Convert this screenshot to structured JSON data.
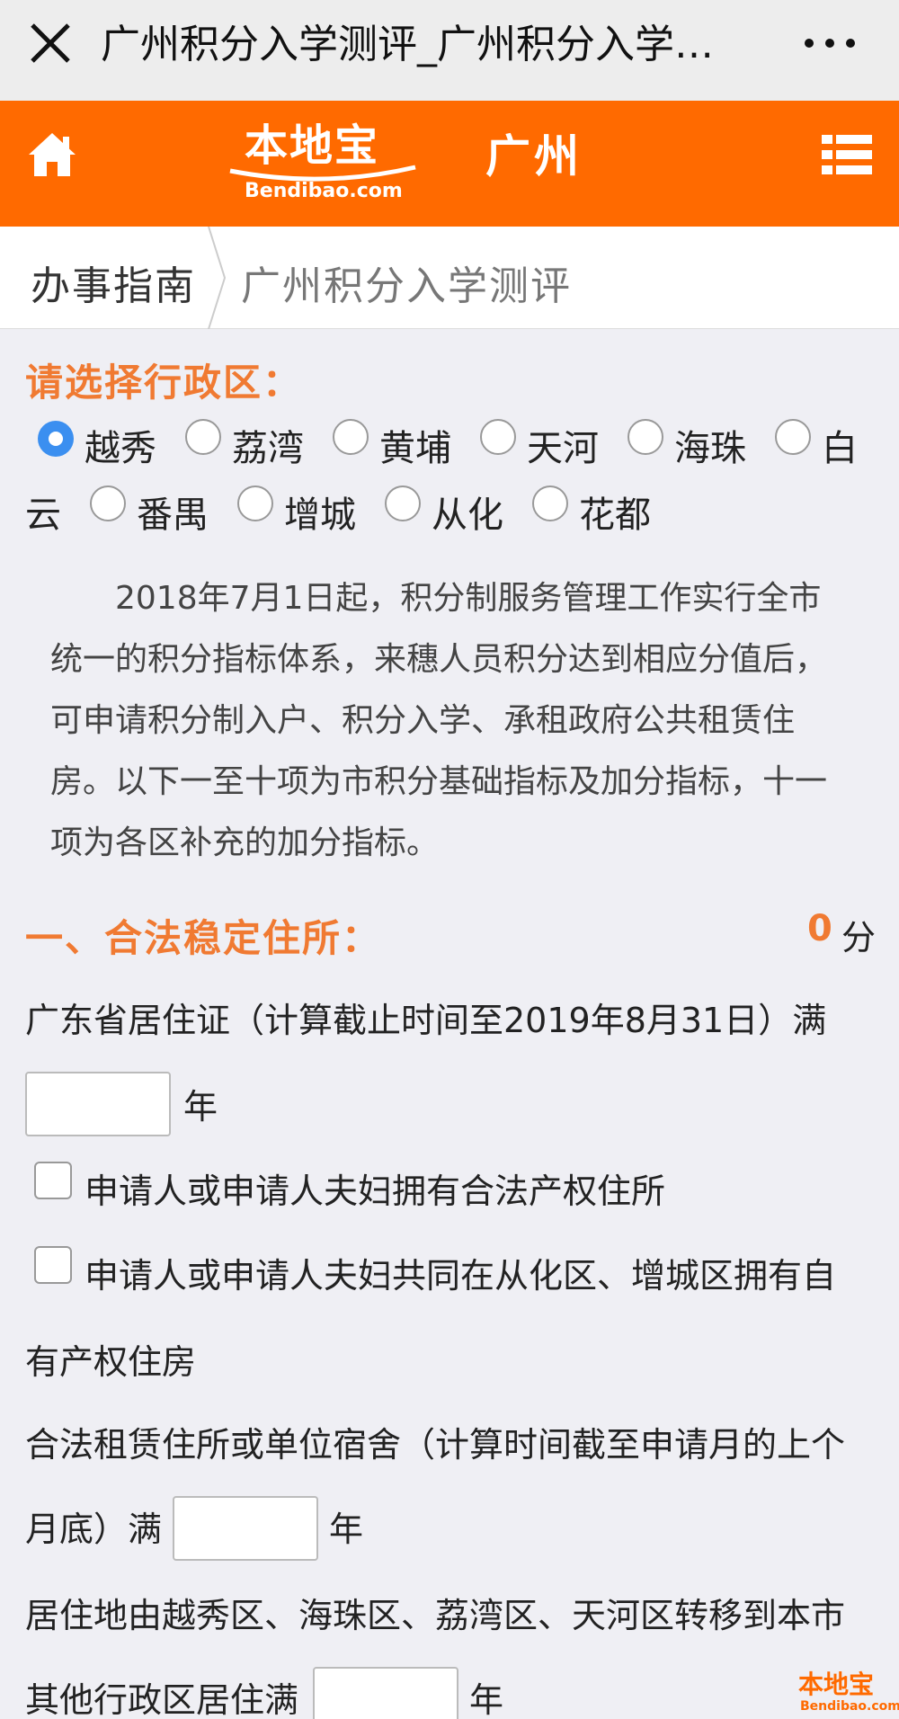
{
  "wechat": {
    "title": "广州积分入学测评_广州积分入学…",
    "close_icon": "close-icon",
    "more_icon": "more-dots-icon"
  },
  "header": {
    "logo_cn": "本地宝",
    "logo_en": "Bendibao.com",
    "city": "广州",
    "bg_color": "#ff6a00"
  },
  "breadcrumb": {
    "parent": "办事指南",
    "current": "广州积分入学测评"
  },
  "district": {
    "title": "请选择行政区：",
    "options": [
      "越秀",
      "荔湾",
      "黄埔",
      "天河",
      "海珠",
      "白",
      "云",
      "番禺",
      "增城",
      "从化",
      "花都"
    ],
    "selected": "越秀"
  },
  "intro": "2018年7月1日起，积分制服务管理工作实行全市统一的积分指标体系，来穗人员积分达到相应分值后，可申请积分制入户、积分入学、承租政府公共租赁住房。以下一至十项为市积分基础指标及加分指标，十一项为各区补充的加分指标。",
  "section1": {
    "title": "一、合法稳定住所：",
    "score": "0",
    "score_unit": "分",
    "residence_permit": "广东省居住证（计算截止时间至2019年8月31日）满",
    "year_unit": "年",
    "own_property": "申请人或申请人夫妇拥有合法产权住所",
    "joint_property_1": "申请人或申请人夫妇共同在从化区、增城区拥有自",
    "joint_property_2": "有产权住房",
    "rental_1": "合法租赁住所或单位宿舍（计算时间截至申请月的上个",
    "rental_2": "月底）满",
    "transfer_1": "居住地由越秀区、海珠区、荔湾区、天河区转移到本市",
    "transfer_2": "其他行政区居住满"
  },
  "watermark": {
    "cn": "本地宝",
    "en": "Bendibao.com"
  }
}
